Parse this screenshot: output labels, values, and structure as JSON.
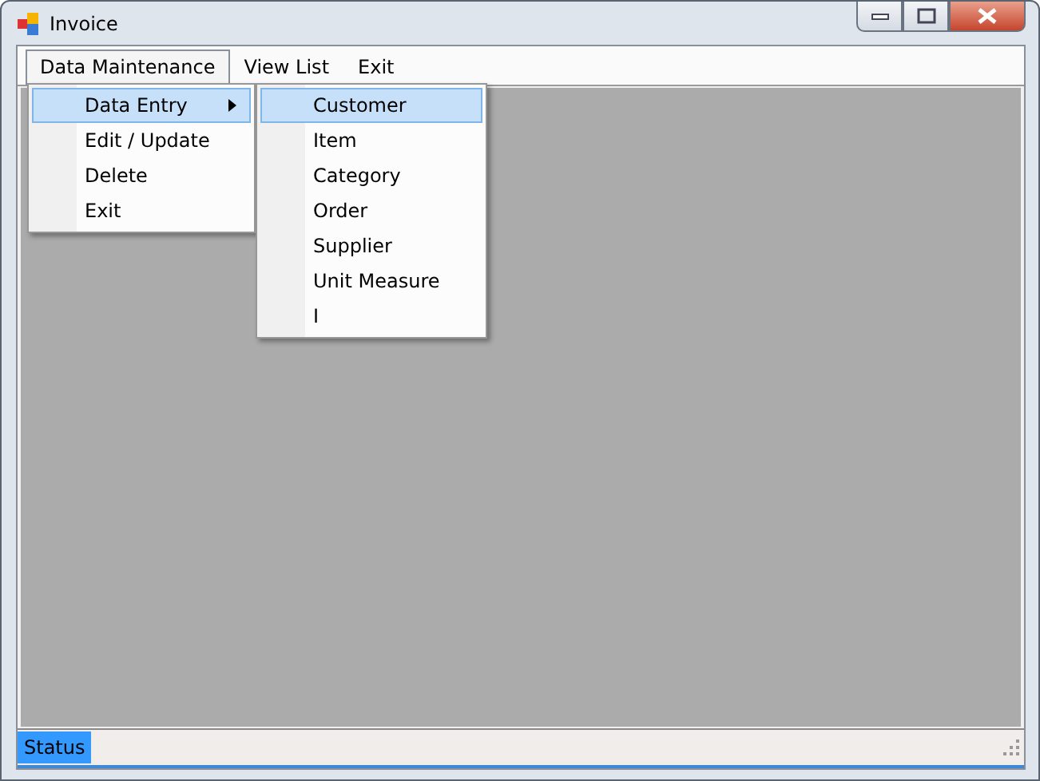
{
  "window": {
    "title": "Invoice"
  },
  "menu_bar": [
    {
      "label": "Data Maintenance",
      "selected": true
    },
    {
      "label": "View List",
      "selected": false
    },
    {
      "label": "Exit",
      "selected": false
    }
  ],
  "dropdown": [
    {
      "label": "Data Entry",
      "selected": true,
      "has_submenu": true
    },
    {
      "label": "Edit / Update",
      "selected": false,
      "has_submenu": false
    },
    {
      "label": "Delete",
      "selected": false,
      "has_submenu": false
    },
    {
      "label": "Exit",
      "selected": false,
      "has_submenu": false
    }
  ],
  "submenu": [
    {
      "label": "Customer",
      "selected": true
    },
    {
      "label": "Item",
      "selected": false
    },
    {
      "label": "Category",
      "selected": false
    },
    {
      "label": "Order",
      "selected": false
    },
    {
      "label": "Supplier",
      "selected": false
    },
    {
      "label": "Unit Measure",
      "selected": false
    },
    {
      "label": "I",
      "selected": false
    }
  ],
  "status_bar": {
    "text": "Status"
  }
}
